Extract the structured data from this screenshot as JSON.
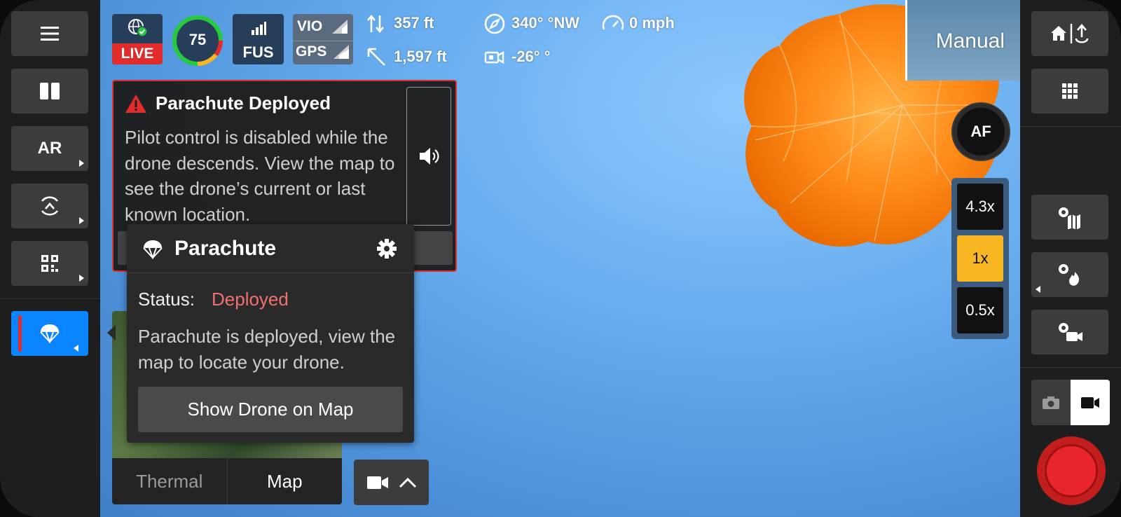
{
  "telemetry": {
    "live_label": "LIVE",
    "battery": "75",
    "fusion_label": "FUS",
    "vio_label": "VIO",
    "gps_label": "GPS",
    "altitude": "357 ft",
    "distance": "1,597 ft",
    "heading": "340° °NW",
    "speed": "0 mph",
    "gimbal_pitch": "-26° °"
  },
  "flight_mode": "Manual",
  "alert": {
    "title": "Parachute Deployed",
    "body": "Pilot control is disabled while the drone descends. View the map to see the drone’s current or last known location."
  },
  "parachute_panel": {
    "title": "Parachute",
    "status_label": "Status:",
    "status_value": "Deployed",
    "description": "Parachute is deployed, view the map to locate your drone.",
    "action_label": "Show Drone on Map"
  },
  "mini_view": {
    "tabs": [
      "Thermal",
      "Map"
    ]
  },
  "left_rail": {
    "ar_label": "AR"
  },
  "camera": {
    "af_label": "AF",
    "zoom_levels": [
      "4.3x",
      "1x",
      "0.5x"
    ],
    "active_zoom": "1x"
  },
  "icons": {
    "menu": "menu-icon",
    "split": "split-view-icon",
    "obstacle": "obstacle-avoidance-icon",
    "qr": "qr-code-icon",
    "parachute": "parachute-icon",
    "home": "return-home-icon",
    "grid": "grid-icon"
  },
  "colors": {
    "accent_blue": "#0a84ff",
    "alert_red": "#e22b2b",
    "status_red": "#f07070",
    "zoom_active": "#f8b620",
    "battery_green": "#27c93f"
  }
}
